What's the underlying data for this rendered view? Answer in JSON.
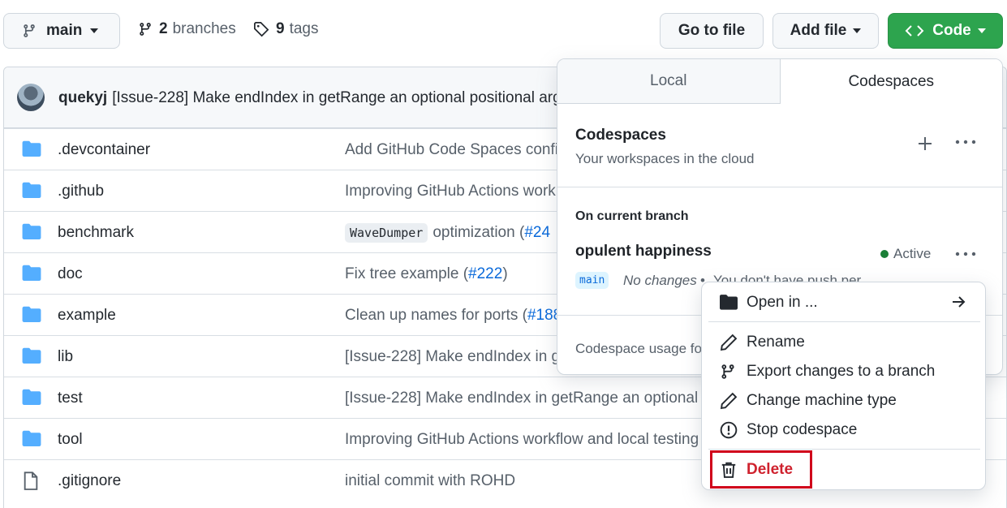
{
  "toolbar": {
    "branch": "main",
    "branches_count": "2",
    "branches_label": "branches",
    "tags_count": "9",
    "tags_label": "tags",
    "goto_file": "Go to file",
    "add_file": "Add file",
    "code": "Code"
  },
  "commit": {
    "author": "quekyj",
    "message": "[Issue-228] Make endIndex in getRange an optional positional arg"
  },
  "files": [
    {
      "name": ".devcontainer",
      "type": "folder",
      "message": "Add GitHub Code Spaces confi",
      "link": ""
    },
    {
      "name": ".github",
      "type": "folder",
      "message": "Improving GitHub Actions work",
      "link": ""
    },
    {
      "name": "benchmark",
      "type": "folder",
      "code": "WaveDumper",
      "message": "optimization (",
      "link": "#24"
    },
    {
      "name": "doc",
      "type": "folder",
      "message": "Fix tree example (",
      "link": "#222",
      "suffix": ")"
    },
    {
      "name": "example",
      "type": "folder",
      "message": "Clean up names for ports (",
      "link": "#188"
    },
    {
      "name": "lib",
      "type": "folder",
      "message": "[Issue-228] Make endIndex in g",
      "link": ""
    },
    {
      "name": "test",
      "type": "folder",
      "message": "[Issue-228] Make endIndex in getRange an optional",
      "link": ""
    },
    {
      "name": "tool",
      "type": "folder",
      "message": "Improving GitHub Actions workflow and local testing",
      "link": ""
    },
    {
      "name": ".gitignore",
      "type": "file",
      "message": "initial commit with ROHD",
      "link": ""
    }
  ],
  "dropdown": {
    "tab_local": "Local",
    "tab_codespaces": "Codespaces",
    "title": "Codespaces",
    "subtitle": "Your workspaces in the cloud",
    "branch_heading": "On current branch",
    "codespace_name": "opulent happiness",
    "status": "Active",
    "status_color": "#1a7f37",
    "branch_tag": "main",
    "no_changes": "No changes",
    "bullet": "•",
    "push_text": "You don't have push per",
    "usage": "Codespace usage for"
  },
  "menu": {
    "open_in": "Open in ...",
    "rename": "Rename",
    "export": "Export changes to a branch",
    "change_machine": "Change machine type",
    "stop": "Stop codespace",
    "delete": "Delete"
  },
  "colors": {
    "accent": "#2da44e",
    "link": "#0969da",
    "danger": "#cf222e",
    "highlight": "#d0021b"
  }
}
